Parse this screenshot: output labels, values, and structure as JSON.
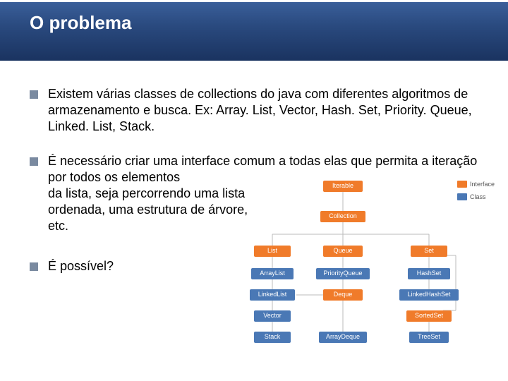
{
  "header": {
    "title": "O problema"
  },
  "bullets": {
    "b1": "Existem várias classes de collections do java com diferentes algoritmos de armazenamento e busca. Ex: Array. List, Vector, Hash. Set, Priority. Queue, Linked. List, Stack.",
    "b2_intro": "É necessário criar uma interface comum a todas elas que permita a iteração por todos os elementos",
    "b2_rest": "da lista, seja percorrendo uma lista ordenada, uma estrutura de árvore, etc.",
    "b3": "É possível?"
  },
  "legend": {
    "interface": "Interface",
    "class": "Class"
  },
  "diagram": {
    "iterable": "Iterable",
    "collection": "Collection",
    "list": "List",
    "queue": "Queue",
    "set": "Set",
    "arraylist": "ArrayList",
    "linkedlist": "LinkedList",
    "vector": "Vector",
    "stack": "Stack",
    "priorityqueue": "PriorityQueue",
    "deque": "Deque",
    "arraydeque": "ArrayDeque",
    "hashset": "HashSet",
    "linkedhashset": "LinkedHashSet",
    "sortedset": "SortedSet",
    "treeset": "TreeSet"
  }
}
